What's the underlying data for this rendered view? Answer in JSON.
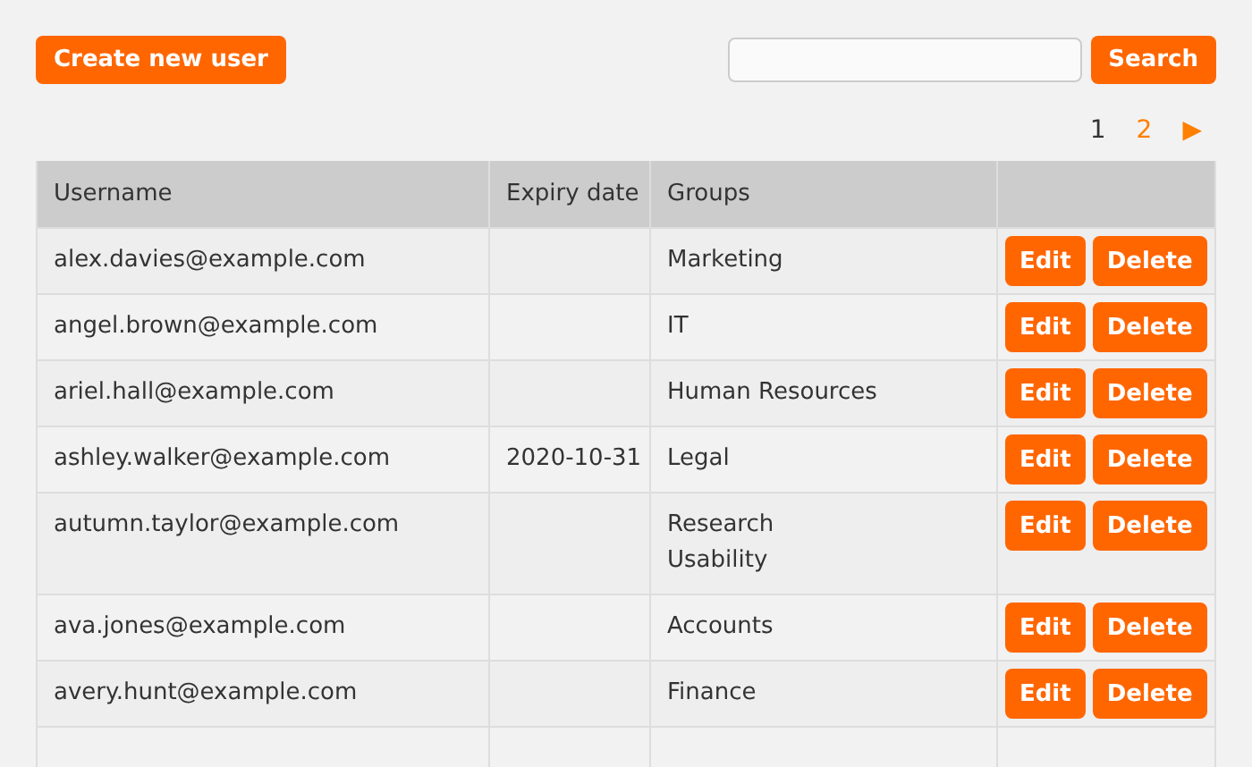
{
  "create_button": "Create new user",
  "search": {
    "button": "Search"
  },
  "pagination": {
    "pages": [
      {
        "label": "1",
        "selected": true
      },
      {
        "label": "2",
        "selected": false
      }
    ],
    "next": "▶"
  },
  "table": {
    "columns": [
      "Username",
      "Expiry date",
      "Groups"
    ],
    "rows": [
      {
        "username": "alex.davies@example.com",
        "groups": [
          "Marketing"
        ],
        "actions": [
          "Edit",
          "Delete"
        ]
      },
      {
        "username": "angel.brown@example.com",
        "groups": [
          "IT"
        ],
        "actions": [
          "Edit",
          "Delete"
        ]
      },
      {
        "username": "ariel.hall@example.com",
        "groups": [
          "Human Resources"
        ],
        "actions": [
          "Edit",
          "Delete"
        ]
      },
      {
        "username": "ashley.walker@example.com",
        "expiry": "2020-10-31",
        "groups": [
          "Legal"
        ],
        "actions": [
          "Edit",
          "Delete"
        ]
      },
      {
        "username": "autumn.taylor@example.com",
        "groups": [
          "Research",
          "Usability"
        ],
        "actions": [
          "Edit",
          "Delete"
        ]
      },
      {
        "username": "ava.jones@example.com",
        "groups": [
          "Accounts"
        ],
        "actions": [
          "Edit",
          "Delete"
        ]
      },
      {
        "username": "avery.hunt@example.com",
        "groups": [
          "Finance"
        ],
        "actions": [
          "Edit",
          "Delete"
        ]
      }
    ]
  }
}
